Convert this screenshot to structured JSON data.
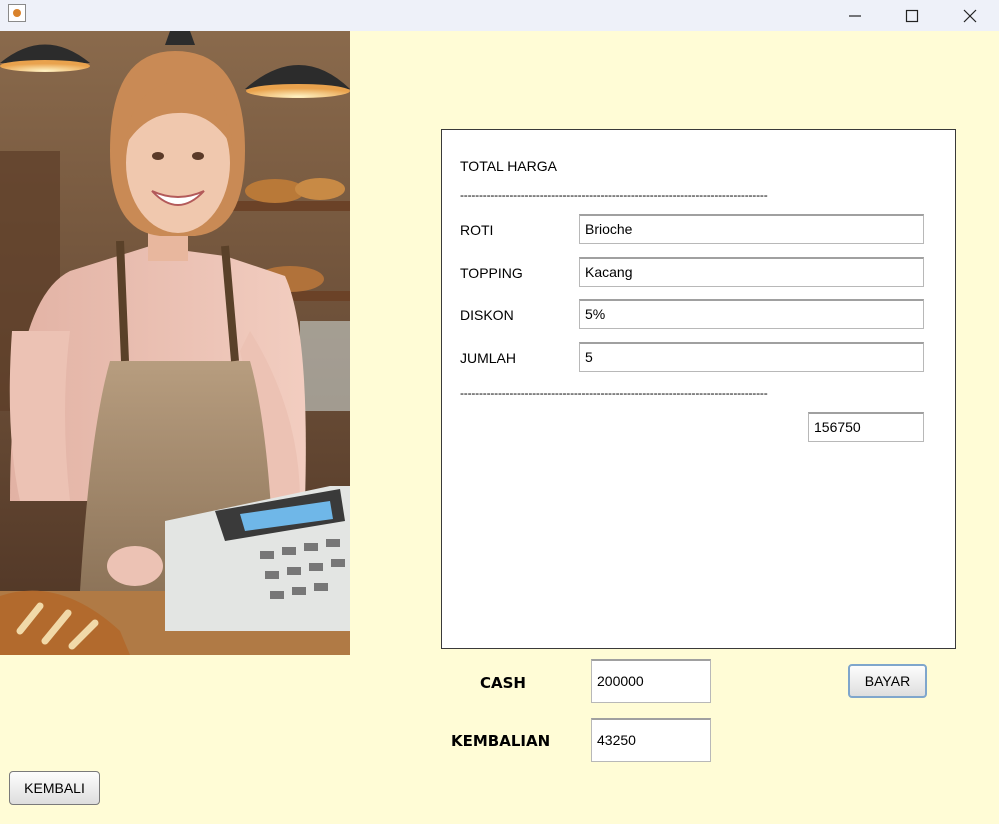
{
  "window": {
    "icons": {
      "app": "java-cup-icon",
      "minimize": "minimize-icon",
      "maximize": "maximize-icon",
      "close": "close-icon"
    }
  },
  "receipt": {
    "title": "TOTAL HARGA",
    "divider": "---------------------------------------------------------------------------------",
    "roti_label": "ROTI",
    "roti_value": "Brioche",
    "topping_label": "TOPPING",
    "topping_value": "Kacang",
    "diskon_label": "DISKON",
    "diskon_value": "5%",
    "jumlah_label": "JUMLAH",
    "jumlah_value": "5",
    "total_value": "156750"
  },
  "payment": {
    "cash_label": "CASH",
    "cash_value": "200000",
    "kembalian_label": "KEMBALIAN",
    "kembalian_value": "43250",
    "bayar_button": "BAYAR"
  },
  "kembali_button": "KEMBALI",
  "colors": {
    "background": "#fffcd6",
    "titlebar": "#eef1f9",
    "panel": "#ffffff"
  }
}
